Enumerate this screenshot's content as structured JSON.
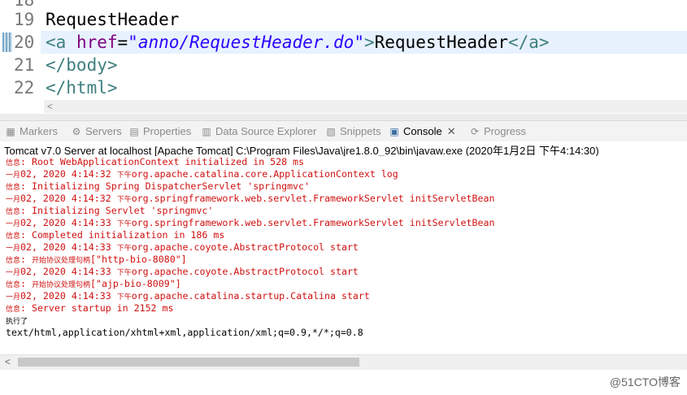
{
  "editor": {
    "lines": [
      {
        "num": "18",
        "text": ""
      },
      {
        "num": "19",
        "text": "RequestHeader"
      },
      {
        "num": "20",
        "open": "<a ",
        "attr": "href",
        "eq": "=",
        "value": "\"anno/RequestHeader.do\"",
        "close": ">",
        "inner": "RequestHeader",
        "end": "</a>"
      },
      {
        "num": "21",
        "text": "</body>"
      },
      {
        "num": "22",
        "text": "</html>"
      }
    ],
    "scroll_arrow": "<"
  },
  "tabs": [
    {
      "label": "Markers",
      "icon": "markers-icon",
      "glyph": "▦"
    },
    {
      "label": "Servers",
      "icon": "servers-icon",
      "glyph": "⚙"
    },
    {
      "label": "Properties",
      "icon": "properties-icon",
      "glyph": "▤"
    },
    {
      "label": "Data Source Explorer",
      "icon": "data-source-icon",
      "glyph": "▥"
    },
    {
      "label": "Snippets",
      "icon": "snippets-icon",
      "glyph": "▧"
    },
    {
      "label": "Console",
      "icon": "console-icon",
      "glyph": "▣"
    },
    {
      "label": "Progress",
      "icon": "progress-icon",
      "glyph": "⟳"
    }
  ],
  "console": {
    "title": "Tomcat v7.0 Server at localhost [Apache Tomcat] C:\\Program Files\\Java\\jre1.8.0_92\\bin\\javaw.exe (2020年1月2日 下午4:14:30)",
    "lines": [
      {
        "prefix": "信息",
        "text": ": Root WebApplicationContext initialized in 528 ms",
        "color": "red"
      },
      {
        "prefix": "一月",
        "text": "02, 2020 4:14:32 ",
        "mid": "下午",
        "rest": "org.apache.catalina.core.ApplicationContext log",
        "color": "red"
      },
      {
        "prefix": "信息",
        "text": ": Initializing Spring DispatcherServlet 'springmvc'",
        "color": "red"
      },
      {
        "prefix": "一月",
        "text": "02, 2020 4:14:32 ",
        "mid": "下午",
        "rest": "org.springframework.web.servlet.FrameworkServlet initServletBean",
        "color": "red"
      },
      {
        "prefix": "信息",
        "text": ": Initializing Servlet 'springmvc'",
        "color": "red"
      },
      {
        "prefix": "一月",
        "text": "02, 2020 4:14:33 ",
        "mid": "下午",
        "rest": "org.springframework.web.servlet.FrameworkServlet initServletBean",
        "color": "red"
      },
      {
        "prefix": "信息",
        "text": ": Completed initialization in 186 ms",
        "color": "red"
      },
      {
        "prefix": "一月",
        "text": "02, 2020 4:14:33 ",
        "mid": "下午",
        "rest": "org.apache.coyote.AbstractProtocol start",
        "color": "red"
      },
      {
        "prefix": "信息",
        "text": ": ",
        "mid": "开始协议处理句柄",
        "rest": "[\"http-bio-8080\"]",
        "color": "red"
      },
      {
        "prefix": "一月",
        "text": "02, 2020 4:14:33 ",
        "mid": "下午",
        "rest": "org.apache.coyote.AbstractProtocol start",
        "color": "red"
      },
      {
        "prefix": "信息",
        "text": ": ",
        "mid": "开始协议处理句柄",
        "rest": "[\"ajp-bio-8009\"]",
        "color": "red"
      },
      {
        "prefix": "一月",
        "text": "02, 2020 4:14:33 ",
        "mid": "下午",
        "rest": "org.apache.catalina.startup.Catalina start",
        "color": "red"
      },
      {
        "prefix": "信息",
        "text": ": Server startup in 2152 ms",
        "color": "red"
      },
      {
        "prefix": "执行了",
        "text": "",
        "color": "black"
      },
      {
        "prefix": "",
        "text": "text/html,application/xhtml+xml,application/xml;q=0.9,*/*;q=0.8",
        "color": "black"
      }
    ]
  },
  "watermark": "@51CTO博客"
}
